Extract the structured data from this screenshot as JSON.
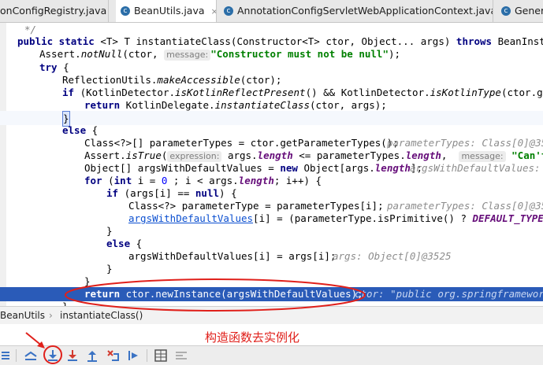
{
  "tabs": [
    {
      "label": "onConfigRegistry.java",
      "active": false,
      "close": ""
    },
    {
      "label": "BeanUtils.java",
      "active": true,
      "close": "×"
    },
    {
      "label": "AnnotationConfigServletWebApplicationContext.java",
      "active": false,
      "close": "×"
    },
    {
      "label": "Generi",
      "active": false,
      "close": ""
    }
  ],
  "code": {
    "l0": "*/",
    "l1_kw": "public static",
    "l1_rest": " <T> T instantiateClass(Constructor<T> ctor, Object... args) ",
    "l1_throws": "throws",
    "l1_tail": " BeanInstantiat",
    "l2_a": "Assert.",
    "l2_fn": "notNull",
    "l2_b": "(ctor, ",
    "l2_hint": "message:",
    "l2_str": "\"Constructor must not be null\"",
    "l2_c": ");",
    "l3_kw": "try",
    "l3_b": " {",
    "l4_a": "ReflectionUtils.",
    "l4_fn": "makeAccessible",
    "l4_b": "(ctor);",
    "l5_kw": "if",
    "l5_a": " (KotlinDetector.",
    "l5_fn1": "isKotlinReflectPresent",
    "l5_b": "() && KotlinDetector.",
    "l5_fn2": "isKotlinType",
    "l5_c": "(ctor.getDecl",
    "l6_kw": "return",
    "l6_a": " KotlinDelegate.",
    "l6_fn": "instantiateClass",
    "l6_b": "(ctor, args);",
    "l7": "}",
    "l8_kw": "else",
    "l8_b": " {",
    "l9_a": "Class<?>[] parameterTypes = ctor.getParameterTypes();",
    "l9_hint": "parameterTypes: Class[0]@3550",
    "l10_a": "Assert.",
    "l10_fn": "isTrue",
    "l10_b": "(",
    "l10_hint": "expression:",
    "l10_c": " args.",
    "l10_fld": "length",
    "l10_d": " <= parameterTypes.",
    "l10_fld2": "length",
    "l10_e": ",  ",
    "l10_hint2": "message:",
    "l10_str": " \"Can't spe",
    "l11_a": "Object[] argsWithDefaultValues = ",
    "l11_kw": "new",
    "l11_b": " Object[args.",
    "l11_fld": "length",
    "l11_c": "];",
    "l11_hint": "argsWithDefaultValues: O",
    "l12_kw": "for",
    "l12_a": " (",
    "l12_kw2": "int",
    "l12_b": " i = ",
    "l12_num": "0",
    "l12_c": " ; i < args.",
    "l12_fld": "length",
    "l12_d": "; i++) {",
    "l13_kw": "if",
    "l13_a": " (args[i] == ",
    "l13_kw2": "null",
    "l13_b": ") {",
    "l14_a": "Class<?> parameterType = parameterTypes[i];",
    "l14_hint": "parameterTypes: Class[0]@3550",
    "l15_ul": "argsWithDefaultValues",
    "l15_a": "[i] = (parameterType.isPrimitive() ? ",
    "l15_fld": "DEFAULT_TYPE_VALU",
    "l16": "}",
    "l17_kw": "else",
    "l17_b": " {",
    "l18_a": "argsWithDefaultValues[i] = args[i];",
    "l18_hint": "args: Object[0]@3525",
    "l19": "}",
    "l20": "}",
    "l21_kw": "return",
    "l21_a": " ctor.newInstance(argsWithDefaultValues);",
    "l21_hint": "ctor: \"public org.springframework.",
    "l22": "}"
  },
  "breadcrumb": {
    "class": "BeanUtils",
    "sep": "›",
    "method": "instantiateClass()"
  },
  "annotation": "构造函数去实例化",
  "colors": {
    "exec_line": "#2a5bb8",
    "annotation_red": "#e0201b",
    "toolbar_blue": "#3b73c4",
    "toolbar_red": "#d23b2f"
  },
  "toolbar_icons": [
    "menu-icon",
    "show-execution-point-icon",
    "step-over-icon",
    "step-into-icon",
    "force-step-into-icon",
    "step-out-icon",
    "drop-frame-icon",
    "run-to-cursor-icon",
    "evaluate-expression-icon",
    "trace-icon"
  ]
}
